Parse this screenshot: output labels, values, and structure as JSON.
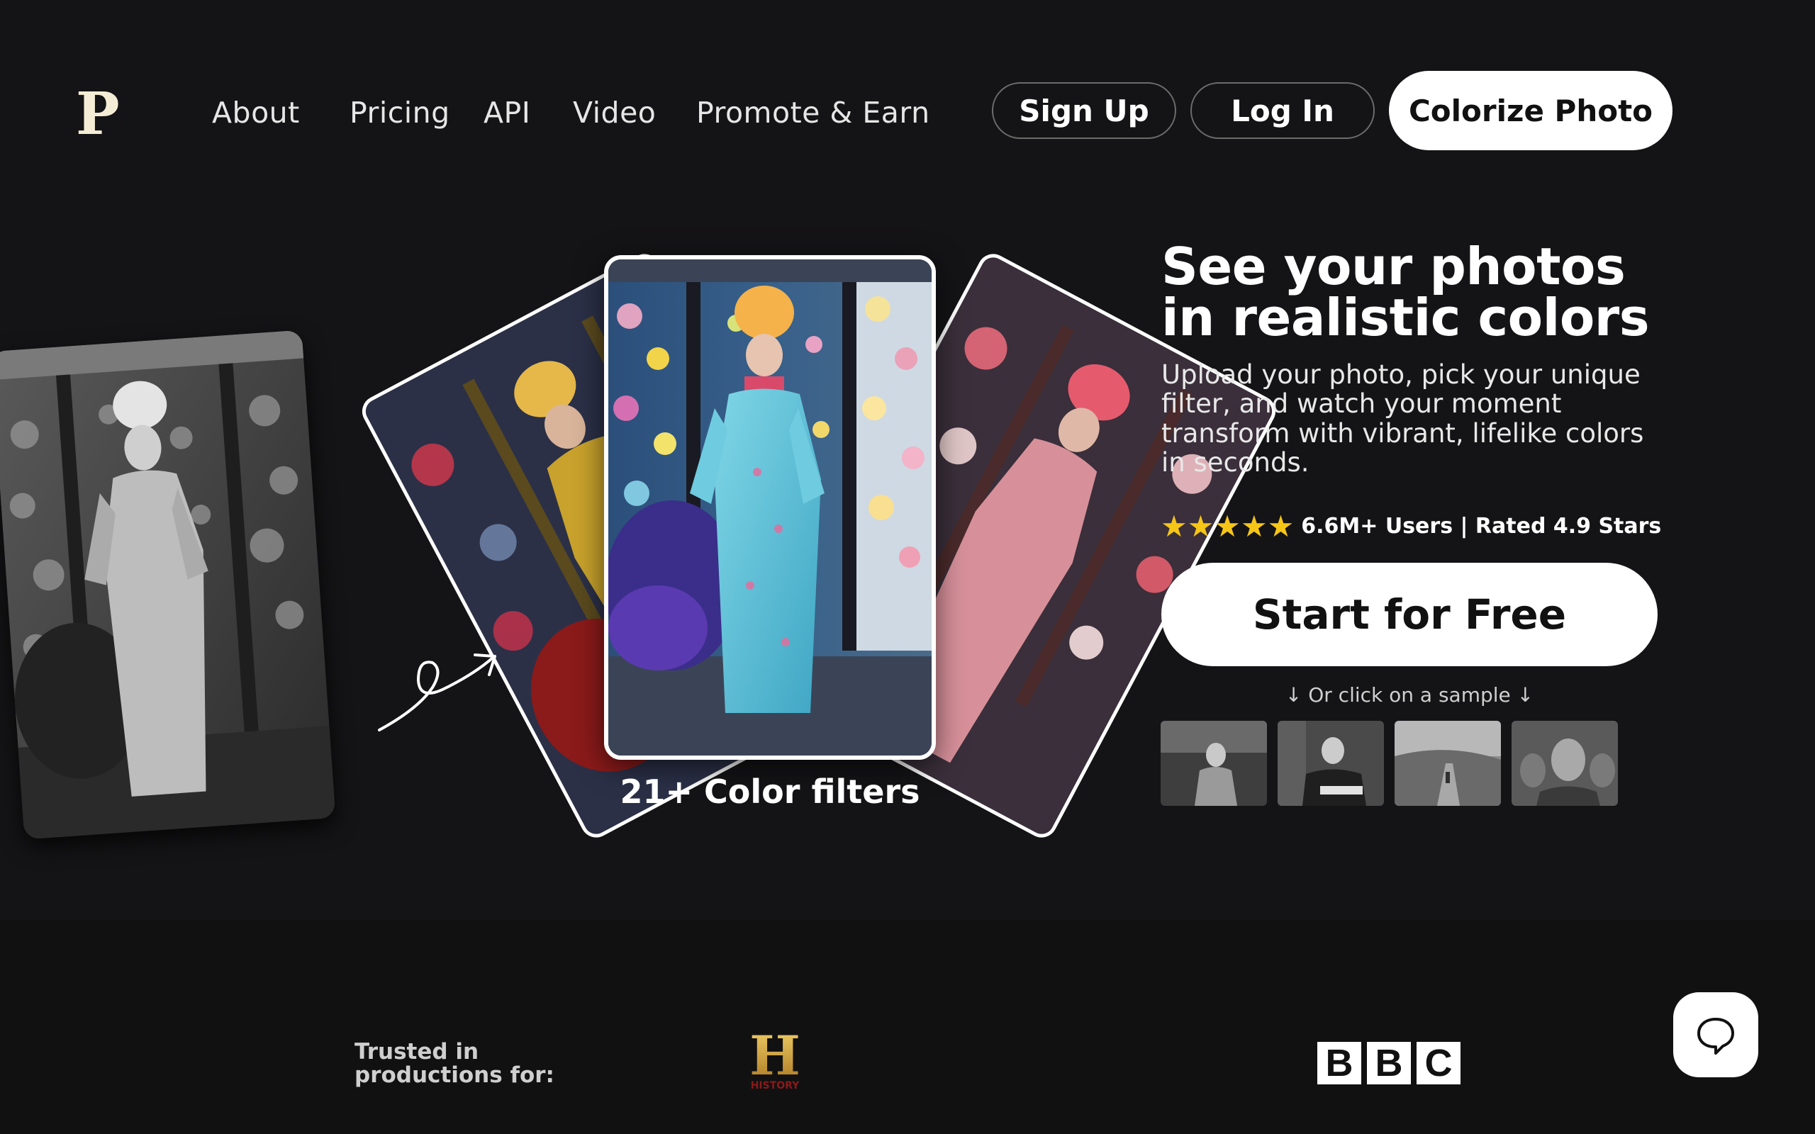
{
  "brand": {
    "logo_letter": "P"
  },
  "nav": {
    "links": [
      "About",
      "Pricing",
      "API",
      "Video",
      "Promote & Earn"
    ],
    "sign_up": "Sign Up",
    "log_in": "Log In",
    "colorize": "Colorize Photo"
  },
  "hero": {
    "caption": "21+ Color filters",
    "headline": "See your photos in realistic colors",
    "subcopy": "Upload your photo, pick your unique filter, and watch your moment transform with vibrant, lifelike colors in seconds.",
    "stars": "★★★★★",
    "rating_text": "6.6M+ Users | Rated 4.9 Stars",
    "cta": "Start for Free",
    "sample_hint": "↓ Or click on a sample ↓"
  },
  "trust": {
    "label_line1": "Trusted in",
    "label_line2": "productions for:",
    "history_letter": "H",
    "history_word": "HISTORY",
    "bbc": [
      "B",
      "B",
      "C"
    ]
  },
  "colors": {
    "background": "#141315",
    "accent_star": "#f5c518",
    "button_white": "#ffffff"
  }
}
